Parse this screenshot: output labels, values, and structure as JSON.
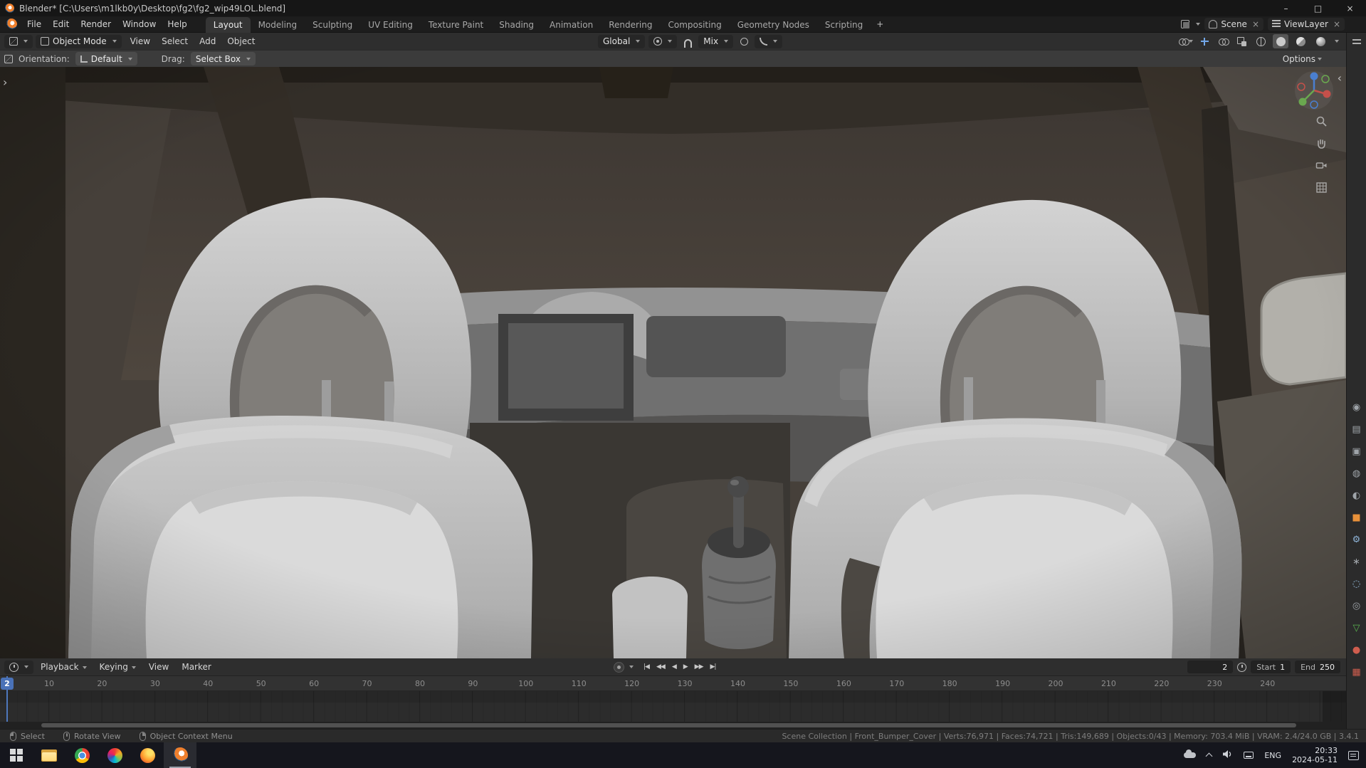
{
  "icons": {
    "toolbar_expand": "›",
    "sidebar_collapse": "‹",
    "close_small": "×"
  },
  "titlebar": {
    "title": "Blender* [C:\\Users\\m1lkb0y\\Desktop\\fg2\\fg2_wip49LOL.blend]",
    "minimize": "–",
    "maximize": "□",
    "close": "×"
  },
  "topbar": {
    "menus": [
      "File",
      "Edit",
      "Render",
      "Window",
      "Help"
    ],
    "workspaces": [
      "Layout",
      "Modeling",
      "Sculpting",
      "UV Editing",
      "Texture Paint",
      "Shading",
      "Animation",
      "Rendering",
      "Compositing",
      "Geometry Nodes",
      "Scripting"
    ],
    "active_workspace": "Layout",
    "add_workspace": "+",
    "scene": "Scene",
    "view_layer": "ViewLayer"
  },
  "viewport_header": {
    "mode": "Object Mode",
    "menus": [
      "View",
      "Select",
      "Add",
      "Object"
    ],
    "orientation": "Global",
    "snap_with": "Mix",
    "options": "Options"
  },
  "tool_bar": {
    "orientation_label": "Orientation:",
    "orientation_value": "Default",
    "drag_label": "Drag:",
    "drag_value": "Select Box"
  },
  "timeline": {
    "menus": [
      "Playback",
      "Keying",
      "View",
      "Marker"
    ],
    "playback_buttons": [
      {
        "name": "jump-to-start-button",
        "glyph": "|◀"
      },
      {
        "name": "prev-keyframe-button",
        "glyph": "◀◀"
      },
      {
        "name": "play-reverse-button",
        "glyph": "◀"
      },
      {
        "name": "play-button",
        "glyph": "▶"
      },
      {
        "name": "next-keyframe-button",
        "glyph": "▶▶"
      },
      {
        "name": "jump-to-end-button",
        "glyph": "▶|"
      }
    ],
    "current_frame": "2",
    "playhead_frame": "2",
    "start_label": "Start",
    "start_value": "1",
    "end_label": "End",
    "end_value": "250",
    "ruler_ticks": [
      "10",
      "20",
      "30",
      "40",
      "50",
      "60",
      "70",
      "80",
      "90",
      "100",
      "110",
      "120",
      "130",
      "140",
      "150",
      "160",
      "170",
      "180",
      "190",
      "200",
      "210",
      "220",
      "230",
      "240"
    ]
  },
  "statusbar": {
    "hints": [
      {
        "icon": "mouse-left-icon",
        "label": "Select"
      },
      {
        "icon": "mouse-middle-icon",
        "label": "Rotate View"
      },
      {
        "icon": "mouse-right-icon",
        "label": "Object Context Menu"
      }
    ],
    "stats": "Scene Collection | Front_Bumper_Cover | Verts:76,971 | Faces:74,721 | Tris:149,689 | Objects:0/43 | Memory: 703.4 MiB | VRAM: 2.4/24.0 GB | 3.4.1"
  },
  "properties_rail": {
    "tabs": [
      {
        "name": "properties-tab-render",
        "glyph": "◉",
        "color": "#9fa4a9"
      },
      {
        "name": "properties-tab-output",
        "glyph": "▤",
        "color": "#9fa4a9"
      },
      {
        "name": "properties-tab-view-layer",
        "glyph": "▣",
        "color": "#9fa4a9"
      },
      {
        "name": "properties-tab-scene",
        "glyph": "◍",
        "color": "#9fa4a9"
      },
      {
        "name": "properties-tab-world",
        "glyph": "◐",
        "color": "#9fa4a9"
      },
      {
        "name": "properties-tab-object",
        "glyph": "■",
        "color": "#e8913a"
      },
      {
        "name": "properties-tab-modifiers",
        "glyph": "⚙",
        "color": "#8fb4d8"
      },
      {
        "name": "properties-tab-particles",
        "glyph": "∗",
        "color": "#9fa4a9"
      },
      {
        "name": "properties-tab-physics",
        "glyph": "◌",
        "color": "#9cc5e8"
      },
      {
        "name": "properties-tab-constraints",
        "glyph": "◎",
        "color": "#9fa4a9"
      },
      {
        "name": "properties-tab-object-data",
        "glyph": "▽",
        "color": "#5bb450"
      },
      {
        "name": "properties-tab-material",
        "glyph": "●",
        "color": "#cf5d4e"
      },
      {
        "name": "properties-tab-texture",
        "glyph": "▦",
        "color": "#cf5d4e"
      }
    ]
  },
  "taskbar": {
    "language": "ENG",
    "time": "20:33",
    "date": "2024-05-11"
  }
}
